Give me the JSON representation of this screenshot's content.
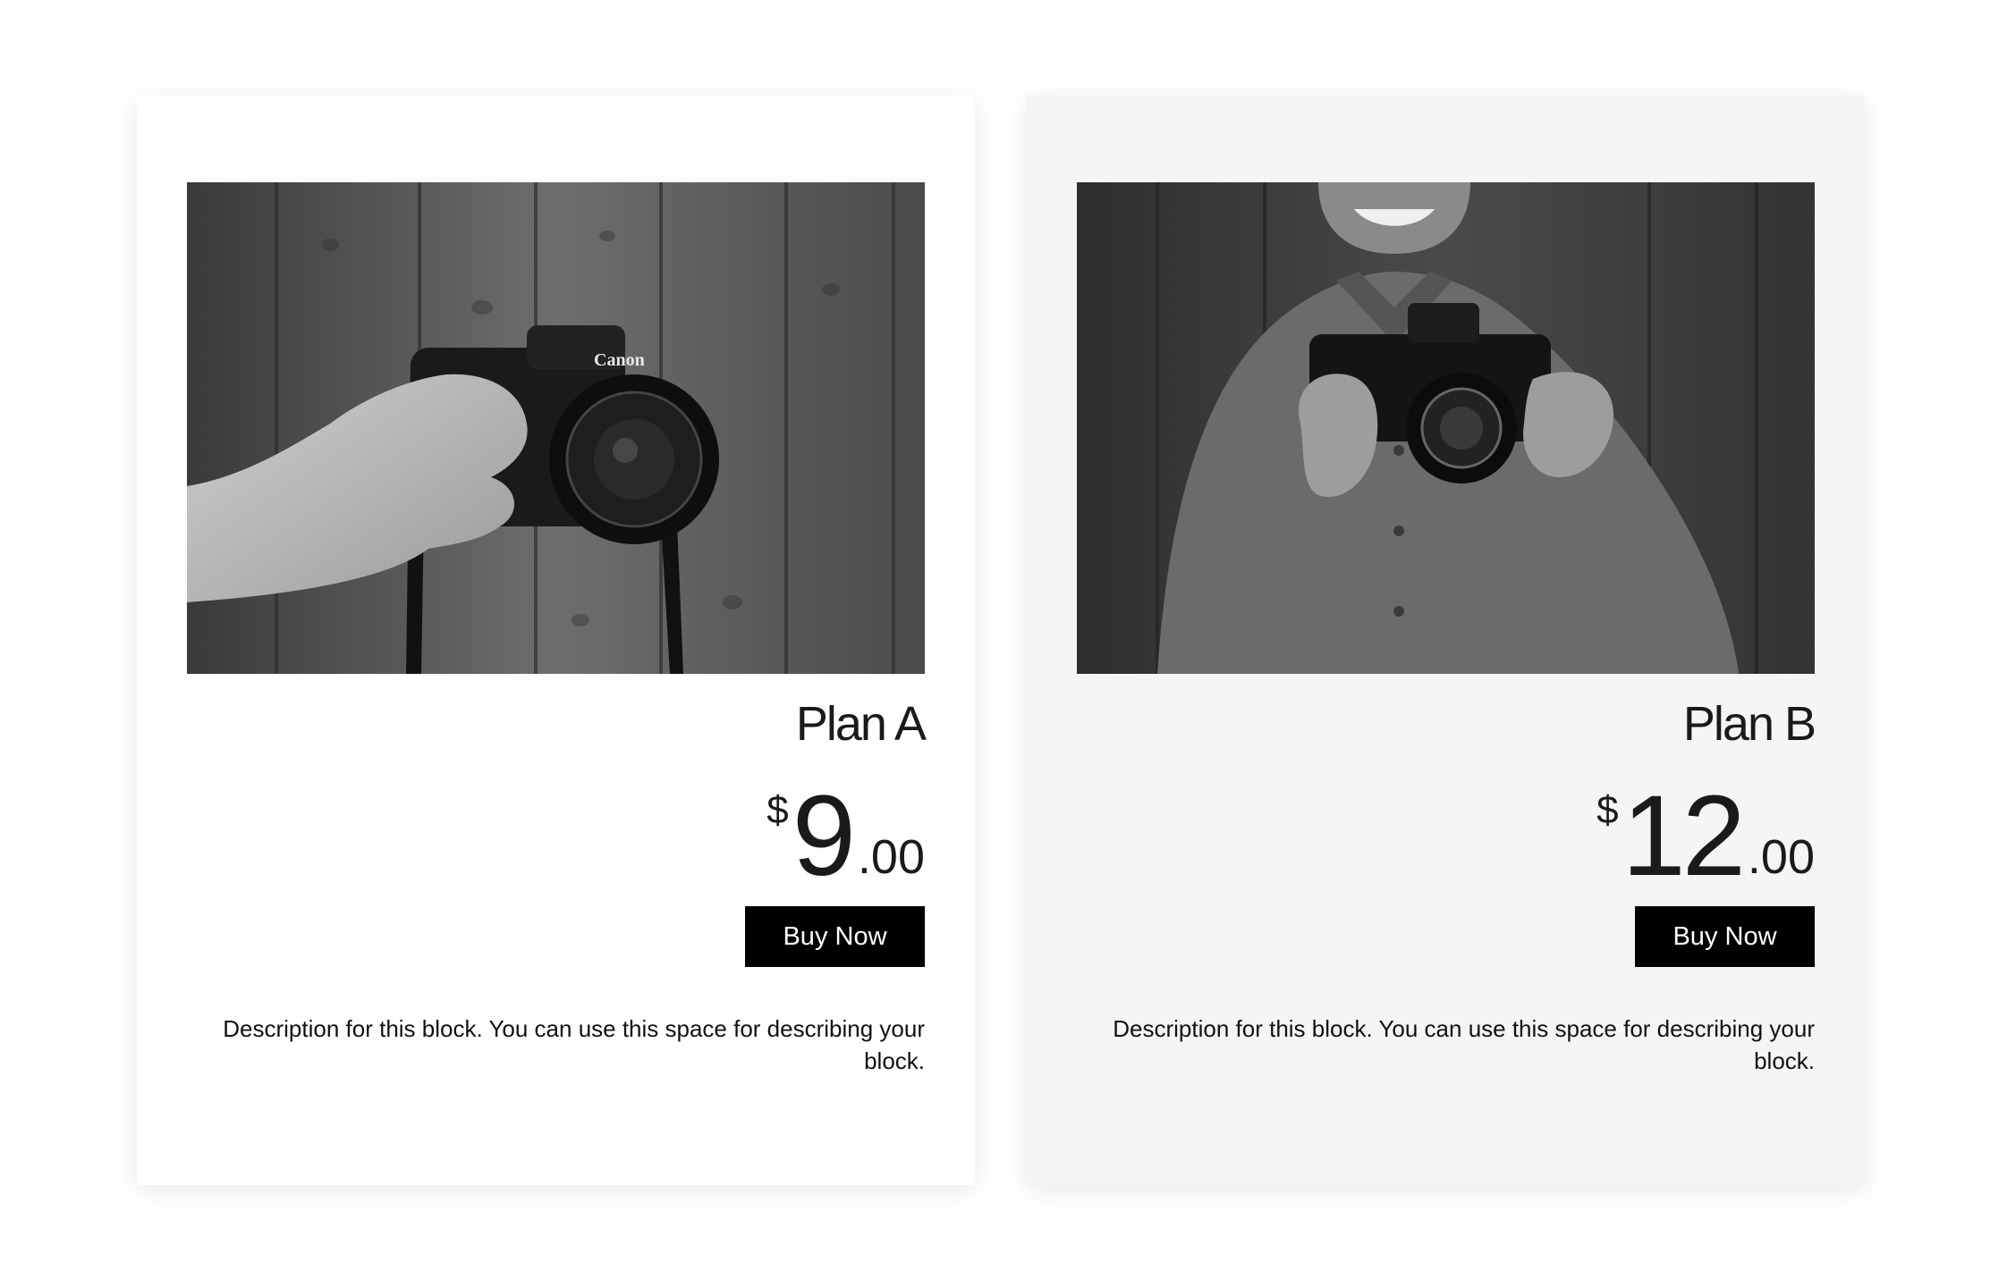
{
  "plans": [
    {
      "name": "Plan A",
      "currency": "$",
      "amount": "9",
      "decimals": ".00",
      "button_label": "Buy Now",
      "description": "Description for this block. You can use this space for describing your block."
    },
    {
      "name": "Plan B",
      "currency": "$",
      "amount": "12",
      "decimals": ".00",
      "button_label": "Buy Now",
      "description": "Description for this block. You can use this space for describing your block."
    }
  ],
  "photo_labels": {
    "camera_brand": "Canon"
  },
  "colors": {
    "card_a_bg": "#ffffff",
    "card_b_bg": "#f5f5f5",
    "button_bg": "#000000",
    "button_text": "#ffffff"
  }
}
